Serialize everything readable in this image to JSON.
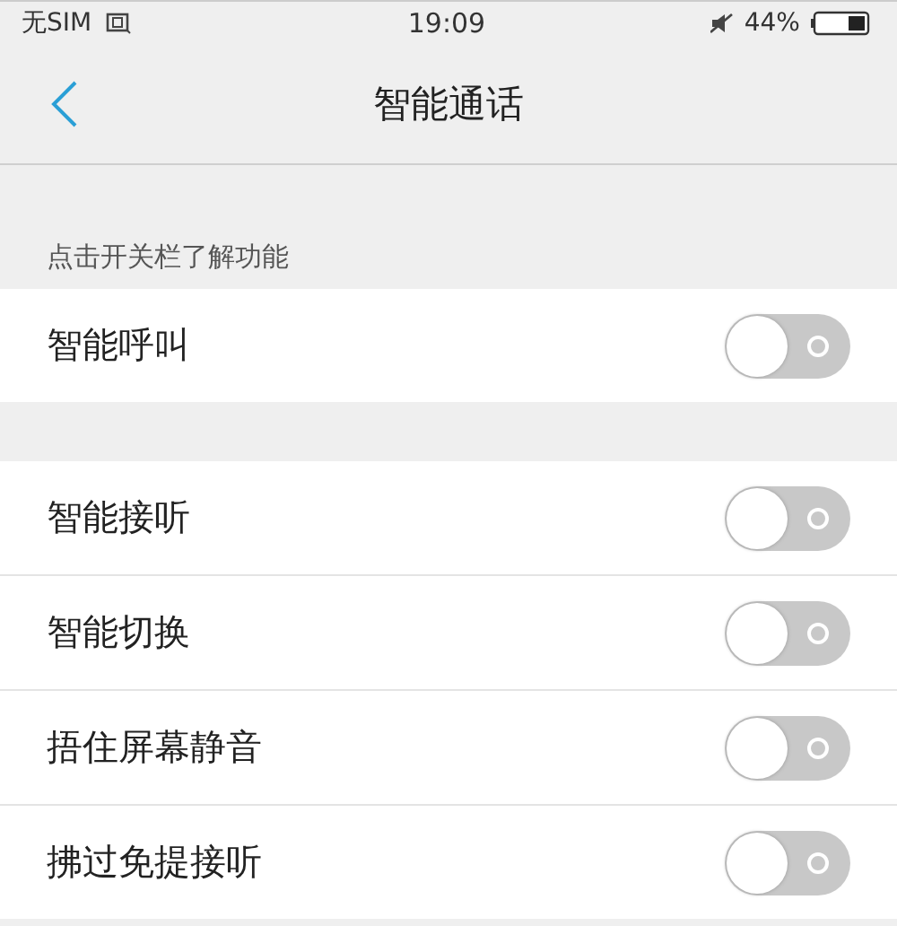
{
  "status_bar": {
    "carrier": "无SIM",
    "time": "19:09",
    "battery": "44%"
  },
  "nav": {
    "title": "智能通话"
  },
  "sections": [
    {
      "header": "点击开关栏了解功能",
      "items": [
        {
          "label": "智能呼叫",
          "on": false
        }
      ]
    },
    {
      "items": [
        {
          "label": "智能接听",
          "on": false
        },
        {
          "label": "智能切换",
          "on": false
        },
        {
          "label": "捂住屏幕静音",
          "on": false
        },
        {
          "label": "拂过免提接听",
          "on": false
        }
      ]
    }
  ]
}
